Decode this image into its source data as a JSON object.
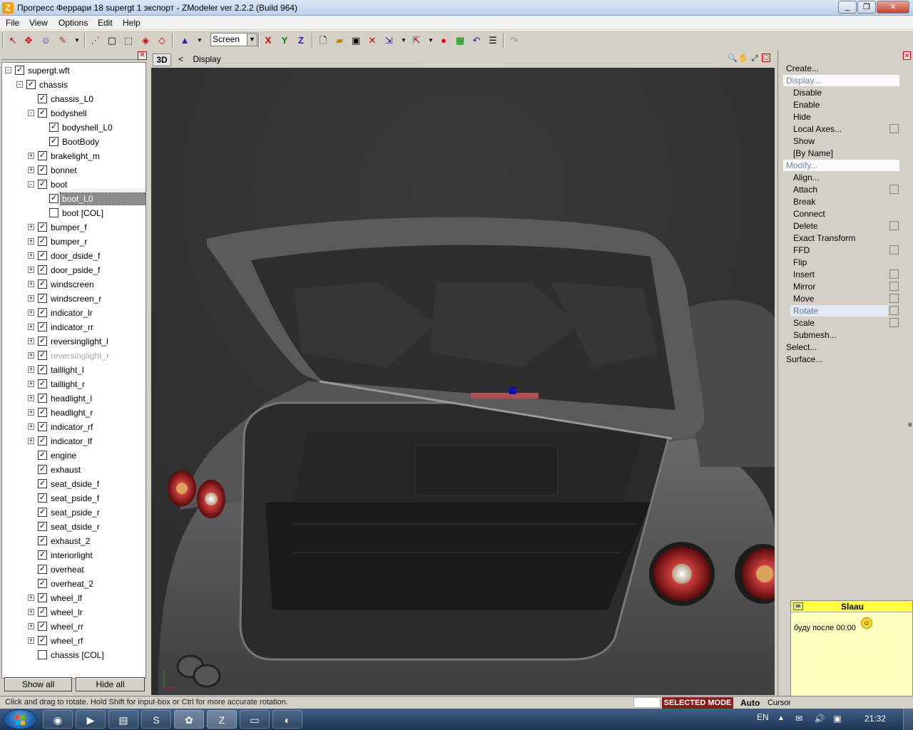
{
  "window": {
    "title": "Прогресс Феррари 18 supergt 1 экспорт - ZModeler ver 2.2.2 (Build 964)",
    "app_icon": "Z"
  },
  "menu": [
    "File",
    "View",
    "Options",
    "Edit",
    "Help"
  ],
  "toolbar": {
    "coord_mode": "Screen",
    "axis_x": "X",
    "axis_y": "Y",
    "axis_z": "Z"
  },
  "tree": {
    "nodes": [
      {
        "label": "supergt.wft",
        "checked": true,
        "expander": "-"
      },
      {
        "label": "chassis",
        "checked": true,
        "expander": "-"
      },
      {
        "label": "chassis_L0",
        "checked": true,
        "expander": ""
      },
      {
        "label": "bodyshell",
        "checked": true,
        "expander": "-"
      },
      {
        "label": "bodyshell_L0",
        "checked": true,
        "expander": ""
      },
      {
        "label": "BootBody",
        "checked": true,
        "expander": ""
      },
      {
        "label": "brakelight_m",
        "checked": true,
        "expander": "+"
      },
      {
        "label": "bonnet",
        "checked": true,
        "expander": "+"
      },
      {
        "label": "boot",
        "checked": true,
        "expander": "-"
      },
      {
        "label": "boot_L0",
        "checked": true,
        "expander": "",
        "selected": true
      },
      {
        "label": "boot [COL]",
        "checked": false,
        "expander": ""
      },
      {
        "label": "bumper_f",
        "checked": true,
        "expander": "+"
      },
      {
        "label": "bumper_r",
        "checked": true,
        "expander": "+"
      },
      {
        "label": "door_dside_f",
        "checked": true,
        "expander": "+"
      },
      {
        "label": "door_pside_f",
        "checked": true,
        "expander": "+"
      },
      {
        "label": "windscreen",
        "checked": true,
        "expander": "+"
      },
      {
        "label": "windscreen_r",
        "checked": true,
        "expander": "+"
      },
      {
        "label": "indicator_lr",
        "checked": true,
        "expander": "+"
      },
      {
        "label": "indicator_rr",
        "checked": true,
        "expander": "+"
      },
      {
        "label": "reversinglight_l",
        "checked": true,
        "expander": "+"
      },
      {
        "label": "reversinglight_r",
        "checked": true,
        "expander": "+",
        "hover": true
      },
      {
        "label": "taillight_l",
        "checked": true,
        "expander": "+"
      },
      {
        "label": "taillight_r",
        "checked": true,
        "expander": "+"
      },
      {
        "label": "headlight_l",
        "checked": true,
        "expander": "+"
      },
      {
        "label": "headlight_r",
        "checked": true,
        "expander": "+"
      },
      {
        "label": "indicator_rf",
        "checked": true,
        "expander": "+"
      },
      {
        "label": "indicator_lf",
        "checked": true,
        "expander": "+"
      },
      {
        "label": "engine",
        "checked": true,
        "expander": ""
      },
      {
        "label": "exhaust",
        "checked": true,
        "expander": ""
      },
      {
        "label": "seat_dside_f",
        "checked": true,
        "expander": ""
      },
      {
        "label": "seat_pside_f",
        "checked": true,
        "expander": ""
      },
      {
        "label": "seat_pside_r",
        "checked": true,
        "expander": ""
      },
      {
        "label": "seat_dside_r",
        "checked": true,
        "expander": ""
      },
      {
        "label": "exhaust_2",
        "checked": true,
        "expander": ""
      },
      {
        "label": "interiorlight",
        "checked": true,
        "expander": ""
      },
      {
        "label": "overheat",
        "checked": true,
        "expander": ""
      },
      {
        "label": "overheat_2",
        "checked": true,
        "expander": ""
      },
      {
        "label": "wheel_lf",
        "checked": true,
        "expander": "+"
      },
      {
        "label": "wheel_lr",
        "checked": true,
        "expander": "+"
      },
      {
        "label": "wheel_rr",
        "checked": true,
        "expander": "+"
      },
      {
        "label": "wheel_rf",
        "checked": true,
        "expander": "+"
      },
      {
        "label": "chassis [COL]",
        "checked": false,
        "expander": ""
      }
    ],
    "show_all": "Show all",
    "hide_all": "Hide all"
  },
  "viewport": {
    "tab": "3D",
    "back": "<",
    "title": "Display"
  },
  "commands": [
    {
      "label": "Create...",
      "kind": "header"
    },
    {
      "label": "Display...",
      "kind": "header-active"
    },
    {
      "label": "Disable",
      "kind": "item"
    },
    {
      "label": "Enable",
      "kind": "item"
    },
    {
      "label": "Hide",
      "kind": "item"
    },
    {
      "label": "Local Axes...",
      "kind": "item",
      "box": true
    },
    {
      "label": "Show",
      "kind": "item"
    },
    {
      "label": "[By Name]",
      "kind": "item"
    },
    {
      "label": "Modify...",
      "kind": "header-active"
    },
    {
      "label": "Align...",
      "kind": "item"
    },
    {
      "label": "Attach",
      "kind": "item",
      "box": true
    },
    {
      "label": "Break",
      "kind": "item"
    },
    {
      "label": "Connect",
      "kind": "item"
    },
    {
      "label": "Delete",
      "kind": "item",
      "box": true
    },
    {
      "label": "Exact Transform",
      "kind": "item"
    },
    {
      "label": "FFD",
      "kind": "item",
      "box": true
    },
    {
      "label": "Flip",
      "kind": "item"
    },
    {
      "label": "Insert",
      "kind": "item",
      "box": true
    },
    {
      "label": "Mirror",
      "kind": "item",
      "box": true
    },
    {
      "label": "Move",
      "kind": "item",
      "box": true
    },
    {
      "label": "Rotate",
      "kind": "item-selected",
      "box": true
    },
    {
      "label": "Scale",
      "kind": "item",
      "box": true
    },
    {
      "label": "Submesh...",
      "kind": "item"
    },
    {
      "label": "Select...",
      "kind": "header"
    },
    {
      "label": "Surface...",
      "kind": "header"
    }
  ],
  "notification": {
    "from": "Slaau",
    "message": "буду после 00:00"
  },
  "status": {
    "hint": "Click and drag to rotate. Hold Shift for input-box or Ctrl for more accurate rotation.",
    "mode": "SELECTED MODE",
    "auto": "Auto",
    "cursor": "Cursor"
  },
  "taskbar": {
    "lang": "EN",
    "time": "21:32"
  }
}
